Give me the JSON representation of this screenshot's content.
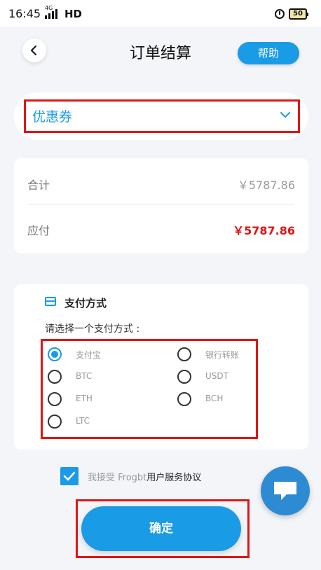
{
  "status_bar": {
    "time": "16:45",
    "network_tag": "4G",
    "network": "HD",
    "battery": "50"
  },
  "header": {
    "title": "订单结算",
    "help_label": "帮助",
    "back_icon": "chevron-left-icon"
  },
  "coupon": {
    "label": "优惠券",
    "icon": "chevron-down-icon"
  },
  "summary": {
    "total_label": "合计",
    "total_value": "￥5787.86",
    "due_label": "应付",
    "due_value": "￥5787.86"
  },
  "payment": {
    "heading": "支付方式",
    "prompt": "请选择一个支付方式 :",
    "options": [
      {
        "label": "支付宝",
        "selected": true
      },
      {
        "label": "银行转账",
        "selected": false
      },
      {
        "label": "BTC",
        "selected": false
      },
      {
        "label": "USDT",
        "selected": false
      },
      {
        "label": "ETH",
        "selected": false
      },
      {
        "label": "BCH",
        "selected": false
      },
      {
        "label": "LTC",
        "selected": false
      }
    ]
  },
  "agreement": {
    "checked": true,
    "prefix": "我接受 Frogbt",
    "link": "用户服务协议"
  },
  "confirm_label": "确定",
  "colors": {
    "accent": "#1a9be6",
    "highlight": "#e01515",
    "price": "#e01515"
  }
}
